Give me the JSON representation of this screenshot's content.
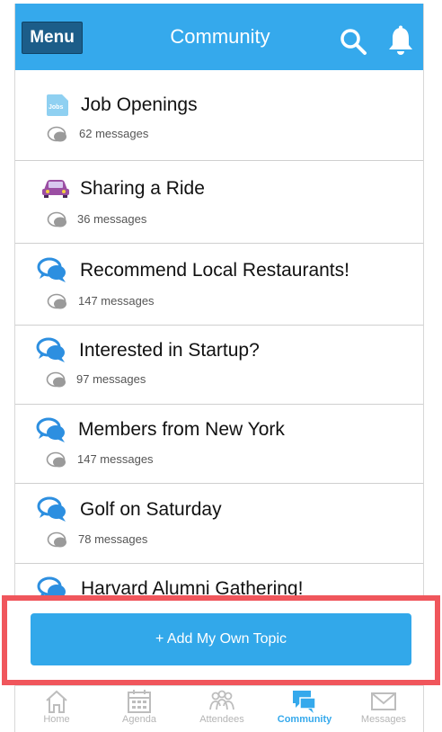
{
  "header": {
    "menu_label": "Menu",
    "title": "Community"
  },
  "topics": [
    {
      "title": "Job Openings",
      "count": "62 messages",
      "icon": "jobs-icon"
    },
    {
      "title": "Sharing a Ride",
      "count": "36 messages",
      "icon": "car-icon"
    },
    {
      "title": "Recommend Local Restaurants!",
      "count": "147 messages",
      "icon": "chat-bubbles-icon"
    },
    {
      "title": "Interested in Startup?",
      "count": "97 messages",
      "icon": "chat-bubbles-icon"
    },
    {
      "title": "Members from New York",
      "count": "147 messages",
      "icon": "chat-bubbles-icon"
    },
    {
      "title": "Golf on Saturday",
      "count": "78 messages",
      "icon": "chat-bubbles-icon"
    },
    {
      "title": "Harvard Alumni Gathering!",
      "count": "",
      "icon": "chat-bubbles-icon"
    }
  ],
  "jobs_icon_text": "Jobs",
  "add_button_label": "+ Add My Own Topic",
  "tabs": [
    {
      "label": "Home",
      "icon": "home-icon",
      "active": false
    },
    {
      "label": "Agenda",
      "icon": "calendar-icon",
      "active": false
    },
    {
      "label": "Attendees",
      "icon": "people-icon",
      "active": false
    },
    {
      "label": "Community",
      "icon": "chat-bubbles-icon",
      "active": true
    },
    {
      "label": "Messages",
      "icon": "envelope-icon",
      "active": false
    }
  ],
  "colors": {
    "header": "#35a9ec",
    "menu_button": "#1c5d89",
    "add_button": "#32a8ea",
    "highlight": "#f0565c",
    "active_tab": "#35a9ec"
  }
}
